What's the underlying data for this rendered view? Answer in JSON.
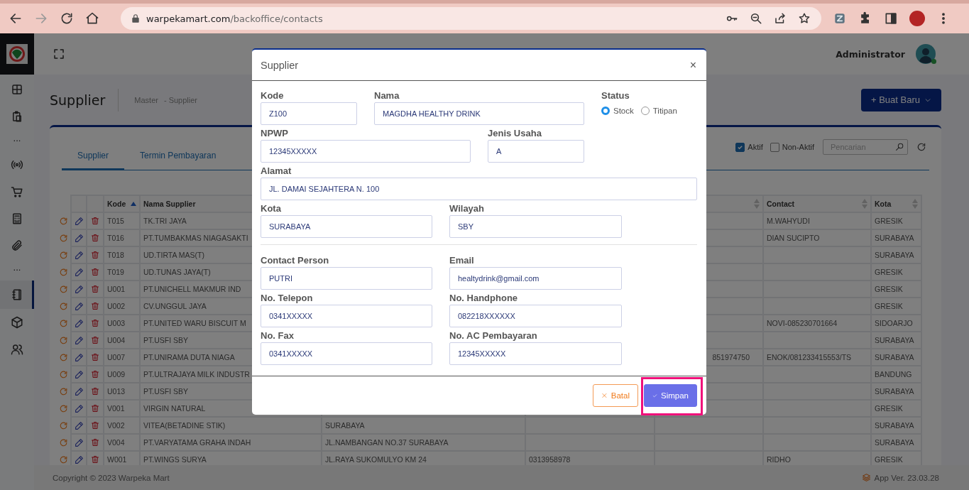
{
  "browser": {
    "url_host": "warpekamart.com",
    "url_path": "/backoffice/contacts"
  },
  "sidebar": {
    "items": [
      {
        "kind": "icon",
        "selected": false
      },
      {
        "kind": "icon",
        "selected": false
      },
      {
        "kind": "label",
        "text": "..."
      },
      {
        "kind": "icon",
        "selected": false
      },
      {
        "kind": "icon",
        "selected": false
      },
      {
        "kind": "icon",
        "selected": false
      },
      {
        "kind": "icon",
        "selected": false
      },
      {
        "kind": "label",
        "text": "..."
      },
      {
        "kind": "icon",
        "selected": true
      },
      {
        "kind": "icon",
        "selected": false
      },
      {
        "kind": "icon",
        "selected": false
      }
    ]
  },
  "header": {
    "user": "Administrator",
    "online": true
  },
  "page": {
    "title": "Supplier",
    "breadcrumb": [
      "Master",
      "- Supplier"
    ],
    "create_button": "+ Buat Baru"
  },
  "tabs": [
    {
      "label": "Supplier",
      "selected": true
    },
    {
      "label": "Termin Pembayaran",
      "selected": false
    }
  ],
  "filters": [
    {
      "label": "Aktif",
      "checked": true
    },
    {
      "label": "Non-Aktif",
      "checked": false
    }
  ],
  "search": {
    "placeholder": "Pencarian"
  },
  "table": {
    "columns": [
      {
        "label": "Kode",
        "sorted_ascending": true
      },
      {
        "label": "Nama Supplier"
      },
      {},
      {},
      {
        "sortable": true,
        "sorted_ascending": false
      },
      {
        "label": "Contact",
        "sortable": true,
        "sorted_ascending": false
      },
      {
        "label": "Kota",
        "sortable": true,
        "sorted_ascending": false
      }
    ],
    "rows": [
      {
        "kode": "T015",
        "nama_supplier": "TK.TRI JAYA",
        "contact": "M.WAHYUDI",
        "kota": "GRESIK"
      },
      {
        "kode": "T016",
        "nama_supplier": "PT.TUMBAKMAS NIAGASAKTI",
        "contact": "DIAN SUCIPTO",
        "kota": "SURABAYA"
      },
      {
        "kode": "T018",
        "nama_supplier": "UD.TIRTA MAS(T)",
        "kota": "SURABAYA"
      },
      {
        "kode": "T019",
        "nama_supplier": "UD.TUNAS JAYA(T)",
        "kota": "GRESIK"
      },
      {
        "kode": "U001",
        "nama_supplier": "PT.UNICHELL MAKMUR IND",
        "kota": "GRESIK"
      },
      {
        "kode": "U002",
        "nama_supplier": "CV.UNGGUL JAYA",
        "kota": "GRESIK"
      },
      {
        "kode": "U003",
        "nama_supplier": "PT.UNITED WARU BISCUIT M",
        "contact": "NOVI-085230701664",
        "kota": "SIDOARJO"
      },
      {
        "kode": "U004",
        "nama_supplier": "PT.USFI SBY",
        "kota": "SURABAYA"
      },
      {
        "kode": "U007",
        "nama_supplier": "PT.UNIRAMA DUTA NIAGA",
        "column_5": "851974750",
        "contact": "ENOK/081233415553/TS",
        "kota": "SURABAYA"
      },
      {
        "kode": "U009",
        "nama_supplier": "PT.ULTRAJAYA MILK INDUSTR",
        "kota": "BANDUNG"
      },
      {
        "kode": "U013",
        "nama_supplier": "PT.USFI SBY",
        "kota": "SURABAYA"
      },
      {
        "kode": "V001",
        "nama_supplier": "VIRGIN NATURAL",
        "kota": "GRESIK"
      },
      {
        "kode": "V002",
        "nama_supplier": "VITEA(BETADINE STIK)",
        "column_3": "SURABAYA",
        "kota": "SURABAYA"
      },
      {
        "kode": "V004",
        "nama_supplier": "PT.VARYATAMA GRAHA INDAH",
        "column_3": "JL.NAMBANGAN NO.37 SURABAYA",
        "kota": "SURABAYA"
      },
      {
        "kode": "W001",
        "nama_supplier": "PT.WINGS SURYA",
        "column_3": "JL.RAYA SUKOMULYO KM 24",
        "column_4": "0313958978",
        "contact": "RIDHO",
        "kota": "GRESIK"
      }
    ]
  },
  "footer": {
    "copyright": "Copyright © 2023 Warpeka Mart",
    "version": "App Ver. 23.03.28"
  },
  "modal": {
    "title": "Supplier",
    "close": "×",
    "sections": [
      {
        "rows": [
          [
            {
              "kind": "text",
              "label": "Kode",
              "value": "Z100"
            },
            {
              "kind": "text",
              "label": "Nama",
              "value": "MAGDHA HEALTHY DRINK"
            },
            {
              "kind": "radio",
              "label": "Status",
              "options": [
                {
                  "label": "Stock",
                  "selected": true
                },
                {
                  "label": "Titipan",
                  "selected": false
                }
              ]
            }
          ],
          [
            {
              "kind": "text",
              "label": "NPWP",
              "value": "12345XXXXX"
            },
            {
              "kind": "text",
              "label": "Jenis Usaha",
              "value": "A"
            }
          ],
          [
            {
              "kind": "text",
              "label": "Alamat",
              "value": "JL. DAMAI SEJAHTERA N. 100"
            }
          ],
          [
            {
              "kind": "text",
              "label": "Kota",
              "value": "SURABAYA"
            },
            {
              "kind": "text",
              "label": "Wilayah",
              "value": "SBY"
            }
          ]
        ]
      },
      {
        "rows": [
          [
            {
              "kind": "text",
              "label": "Contact Person",
              "value": "PUTRI"
            },
            {
              "kind": "text",
              "label": "Email",
              "value": "healtydrink@gmail.com"
            }
          ],
          [
            {
              "kind": "text",
              "label": "No. Telepon",
              "value": "0341XXXXX"
            },
            {
              "kind": "text",
              "label": "No. Handphone",
              "value": "082218XXXXXX"
            }
          ],
          [
            {
              "kind": "text",
              "label": "No. Fax",
              "value": "0341XXXXX"
            },
            {
              "kind": "text",
              "label": "No. AC Pembayaran",
              "value": "12345XXXXX"
            }
          ]
        ]
      }
    ],
    "buttons": [
      {
        "kind": "cancel",
        "label": "Batal",
        "highlighted": false
      },
      {
        "kind": "save",
        "label": "Simpan",
        "highlighted": true
      }
    ]
  }
}
